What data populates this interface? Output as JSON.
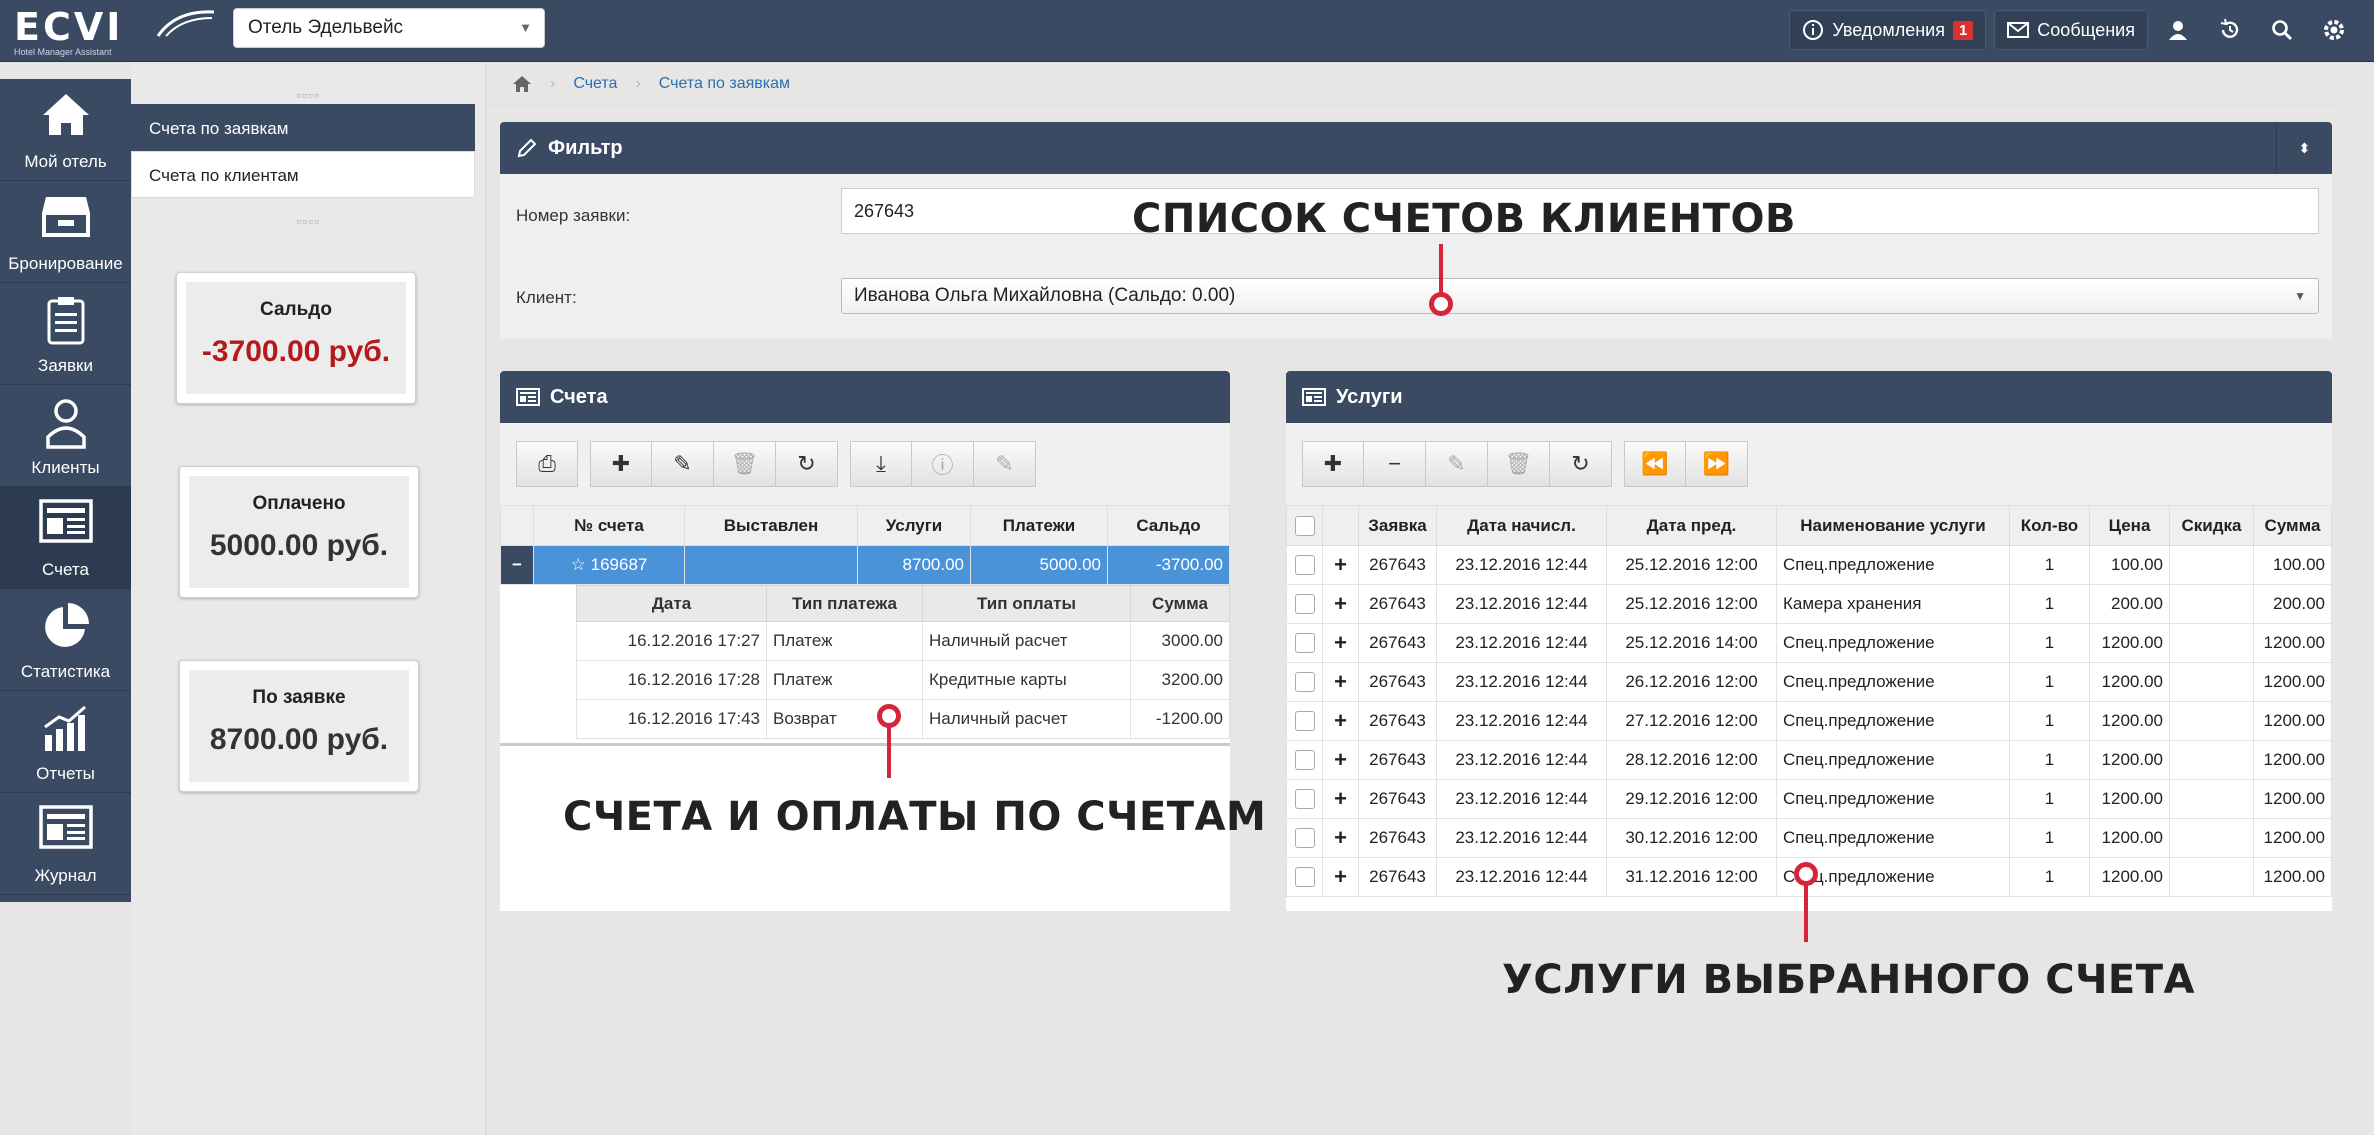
{
  "header": {
    "logo_text": "ECVI",
    "logo_sub": "Hotel Manager Assistant",
    "hotel_select": "Отель Эдельвейс",
    "notifications_label": "Уведомления",
    "notifications_count": "1",
    "messages_label": "Сообщения"
  },
  "nav": {
    "items": [
      {
        "label": "Мой отель",
        "icon": "home-icon"
      },
      {
        "label": "Бронирование",
        "icon": "inbox-icon"
      },
      {
        "label": "Заявки",
        "icon": "clipboard-icon"
      },
      {
        "label": "Клиенты",
        "icon": "user-icon"
      },
      {
        "label": "Счета",
        "icon": "invoice-icon"
      },
      {
        "label": "Статистика",
        "icon": "pie-chart-icon"
      },
      {
        "label": "Отчеты",
        "icon": "bar-chart-icon"
      },
      {
        "label": "Журнал",
        "icon": "journal-icon"
      }
    ]
  },
  "sidebar": {
    "links": [
      "Счета по заявкам",
      "Счета по клиентам"
    ],
    "stats": [
      {
        "title": "Сальдо",
        "value": "-3700.00 руб."
      },
      {
        "title": "Оплачено",
        "value": "5000.00 руб."
      },
      {
        "title": "По заявке",
        "value": "8700.00 руб."
      }
    ]
  },
  "breadcrumb": [
    "Счета",
    "Счета по заявкам"
  ],
  "filter": {
    "title": "Фильтр",
    "order_label": "Номер заявки:",
    "order_value": "267643",
    "client_label": "Клиент:",
    "client_value": "Иванова Ольга Михайловна (Сальдо: 0.00)"
  },
  "accounts": {
    "title": "Счета",
    "columns": [
      "№ счета",
      "Выставлен",
      "Услуги",
      "Платежи",
      "Сальдо"
    ],
    "row": {
      "expander": "−",
      "number": "169687",
      "issued": "",
      "services": "8700.00",
      "payments": "5000.00",
      "balance": "-3700.00"
    },
    "payments_columns": [
      "Дата",
      "Тип платежа",
      "Тип оплаты",
      "Сумма"
    ],
    "payments": [
      [
        "16.12.2016 17:27",
        "Платеж",
        "Наличный расчет",
        "3000.00"
      ],
      [
        "16.12.2016 17:28",
        "Платеж",
        "Кредитные карты",
        "3200.00"
      ],
      [
        "16.12.2016 17:43",
        "Возврат",
        "Наличный расчет",
        "-1200.00"
      ]
    ]
  },
  "services": {
    "title": "Услуги",
    "columns": [
      "Заявка",
      "Дата начисл.",
      "Дата пред.",
      "Наименование услуги",
      "Кол-во",
      "Цена",
      "Скидка",
      "Сумма"
    ],
    "rows": [
      [
        "267643",
        "23.12.2016 12:44",
        "25.12.2016 12:00",
        "Спец.предложение",
        "1",
        "100.00",
        "",
        "100.00"
      ],
      [
        "267643",
        "23.12.2016 12:44",
        "25.12.2016 12:00",
        "Камера хранения",
        "1",
        "200.00",
        "",
        "200.00"
      ],
      [
        "267643",
        "23.12.2016 12:44",
        "25.12.2016 14:00",
        "Спец.предложение",
        "1",
        "1200.00",
        "",
        "1200.00"
      ],
      [
        "267643",
        "23.12.2016 12:44",
        "26.12.2016 12:00",
        "Спец.предложение",
        "1",
        "1200.00",
        "",
        "1200.00"
      ],
      [
        "267643",
        "23.12.2016 12:44",
        "27.12.2016 12:00",
        "Спец.предложение",
        "1",
        "1200.00",
        "",
        "1200.00"
      ],
      [
        "267643",
        "23.12.2016 12:44",
        "28.12.2016 12:00",
        "Спец.предложение",
        "1",
        "1200.00",
        "",
        "1200.00"
      ],
      [
        "267643",
        "23.12.2016 12:44",
        "29.12.2016 12:00",
        "Спец.предложение",
        "1",
        "1200.00",
        "",
        "1200.00"
      ],
      [
        "267643",
        "23.12.2016 12:44",
        "30.12.2016 12:00",
        "Спец.предложение",
        "1",
        "1200.00",
        "",
        "1200.00"
      ],
      [
        "267643",
        "23.12.2016 12:44",
        "31.12.2016 12:00",
        "Спец.предложение",
        "1",
        "1200.00",
        "",
        "1200.00"
      ]
    ]
  },
  "annotations": {
    "clients_list": "СПИСОК СЧЕТОВ КЛИЕНТОВ",
    "accounts_payments": "СЧЕТА И ОПЛАТЫ ПО СЧЕТАМ",
    "selected_services": "УСЛУГИ ВЫБРАННОГО СЧЕТА"
  },
  "colors": {
    "header": "#3a4a63",
    "selected_row": "#4a93d9",
    "negative": "#b5191b",
    "pin": "#d6243a"
  }
}
